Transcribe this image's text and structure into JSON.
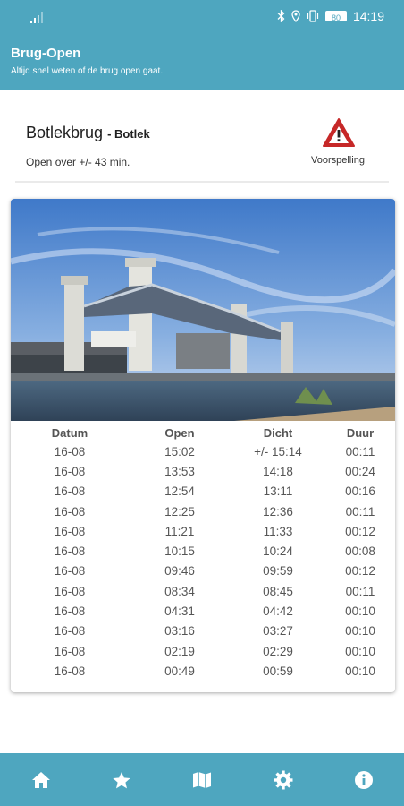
{
  "status_bar": {
    "time": "14:19",
    "battery": "80"
  },
  "header": {
    "title": "Brug-Open",
    "subtitle": "Altijd snel weten of de brug open gaat."
  },
  "bridge": {
    "name": "Botlekbrug",
    "location": "- Botlek",
    "open_in": "Open over +/- 43 min.",
    "forecast_label": "Voorspelling"
  },
  "table": {
    "headers": [
      "Datum",
      "Open",
      "Dicht",
      "Duur"
    ],
    "rows": [
      [
        "16-08",
        "15:02",
        "+/- 15:14",
        "00:11"
      ],
      [
        "16-08",
        "13:53",
        "14:18",
        "00:24"
      ],
      [
        "16-08",
        "12:54",
        "13:11",
        "00:16"
      ],
      [
        "16-08",
        "12:25",
        "12:36",
        "00:11"
      ],
      [
        "16-08",
        "11:21",
        "11:33",
        "00:12"
      ],
      [
        "16-08",
        "10:15",
        "10:24",
        "00:08"
      ],
      [
        "16-08",
        "09:46",
        "09:59",
        "00:12"
      ],
      [
        "16-08",
        "08:34",
        "08:45",
        "00:11"
      ],
      [
        "16-08",
        "04:31",
        "04:42",
        "00:10"
      ],
      [
        "16-08",
        "03:16",
        "03:27",
        "00:10"
      ],
      [
        "16-08",
        "02:19",
        "02:29",
        "00:10"
      ],
      [
        "16-08",
        "00:49",
        "00:59",
        "00:10"
      ]
    ]
  },
  "nav": [
    {
      "icon": "home-icon"
    },
    {
      "icon": "star-icon"
    },
    {
      "icon": "map-icon"
    },
    {
      "icon": "gear-icon"
    },
    {
      "icon": "info-icon"
    }
  ],
  "colors": {
    "primary": "#4ea6bf",
    "warning": "#c62828"
  }
}
